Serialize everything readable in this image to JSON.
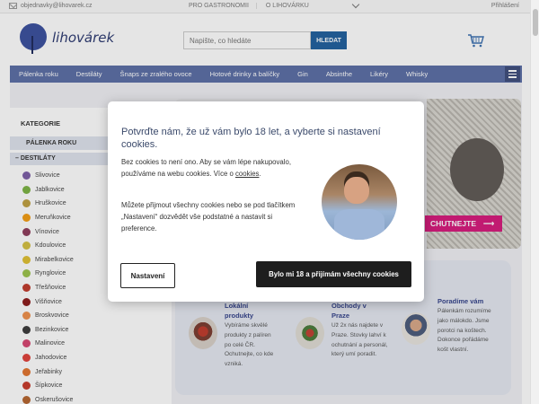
{
  "topbar": {
    "email": "objednavky@lihovarek.cz",
    "links": [
      "PRO GASTRONOMII",
      "O LIHOVÁRKU"
    ],
    "login": "Přihlášení"
  },
  "header": {
    "logo_text": "lihovárek",
    "search_placeholder": "Napište, co hledáte",
    "search_button": "HLEDAT"
  },
  "nav": {
    "items": [
      "Pálenka roku",
      "Destiláty",
      "Šnaps ze zralého ovoce",
      "Hotové drinky a balíčky",
      "Gin",
      "Absinthe",
      "Likéry",
      "Whisky"
    ]
  },
  "sidebar": {
    "heading": "KATEGORIE",
    "top_category": "PÁLENKA ROKU",
    "open_category": "DESTILÁTY",
    "items": [
      {
        "label": "Slivovice",
        "color": "#7b5ea7"
      },
      {
        "label": "Jablkovice",
        "color": "#7cb342"
      },
      {
        "label": "Hruškovice",
        "color": "#c0a040"
      },
      {
        "label": "Meruňkovice",
        "color": "#f39c12"
      },
      {
        "label": "Vínovice",
        "color": "#8e3b5a"
      },
      {
        "label": "Kdoulovice",
        "color": "#d4c040"
      },
      {
        "label": "Mirabelkovice",
        "color": "#e0c030"
      },
      {
        "label": "Rynglovice",
        "color": "#9bc34a"
      },
      {
        "label": "Třešňovice",
        "color": "#c0392b"
      },
      {
        "label": "Višňovice",
        "color": "#8b1a1a"
      },
      {
        "label": "Broskvovice",
        "color": "#f0904a"
      },
      {
        "label": "Bezinkovice",
        "color": "#3a3a3a"
      },
      {
        "label": "Malinovice",
        "color": "#d64570"
      },
      {
        "label": "Jahodovice",
        "color": "#e0403a"
      },
      {
        "label": "Jeřabinky",
        "color": "#e2742e"
      },
      {
        "label": "Šípkovice",
        "color": "#c83a2a"
      },
      {
        "label": "Oskerušovice",
        "color": "#b5652e"
      }
    ]
  },
  "hero": {
    "cta": "CHUTNEJTE"
  },
  "info": [
    {
      "title": "Lokální produkty",
      "text": "Vybíráme skvělé produkty z palíren po celé ČR. Ochutnejte, co kde vzniká."
    },
    {
      "title": "Obchody v Praze",
      "text": "Už 2x nás najdete v Praze. Stovky lahví k ochutnání a personál, který umí poradit."
    },
    {
      "title": "Poradíme vám",
      "text": "Pálenkám rozumíme jako málokdo. Jsme porotci na koštech. Dokonce pořádáme košt vlastní."
    }
  ],
  "modal": {
    "title": "Potvrďte nám, že už vám bylo 18 let, a vyberte si nastavení cookies.",
    "p1_before": "Bez cookies to není ono. Aby se vám lépe nakupovalo, používáme na webu cookies. Více o ",
    "p1_link": "cookies",
    "p1_after": ".",
    "p2": "Můžete přijmout všechny cookies nebo se pod tlačítkem „Nastavení“ dozvědět vše podstatné a nastavit si preference.",
    "settings_button": "Nastavení",
    "accept_button": "Bylo mi 18 a přijímám všechny cookies"
  }
}
